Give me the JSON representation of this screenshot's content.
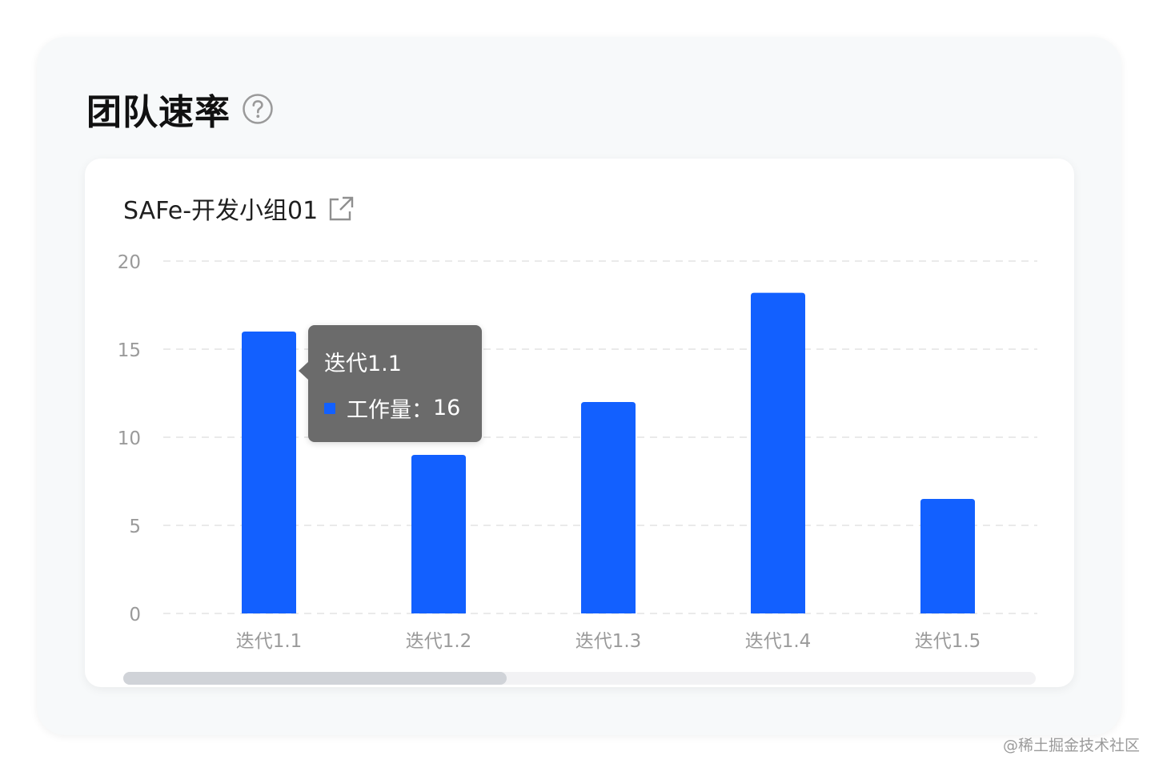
{
  "panel": {
    "title": "团队速率",
    "help_icon": "question-circle-icon"
  },
  "card": {
    "name": "SAFe-开发小组01",
    "external_icon": "external-link-icon"
  },
  "colors": {
    "bar": "#1260ff",
    "tooltip_bg": "#6b6b6b",
    "axis_label": "#9a9a9a",
    "grid": "#e3e3e3"
  },
  "chart_data": {
    "type": "bar",
    "categories": [
      "迭代1.1",
      "迭代1.2",
      "迭代1.3",
      "迭代1.4",
      "迭代1.5"
    ],
    "series": [
      {
        "name": "工作量",
        "values": [
          16,
          9,
          12,
          18.2,
          6.5
        ]
      }
    ],
    "yticks": [
      "0",
      "5",
      "10",
      "15",
      "20"
    ],
    "ylim": [
      0,
      20
    ],
    "grid": true,
    "title": "",
    "xlabel": "",
    "ylabel": ""
  },
  "tooltip": {
    "title": "迭代1.1",
    "series_label": "工作量",
    "separator": "：",
    "value": "16"
  },
  "scrollbar": {
    "visible_fraction": 0.42
  },
  "watermark": "@稀土掘金技术社区"
}
